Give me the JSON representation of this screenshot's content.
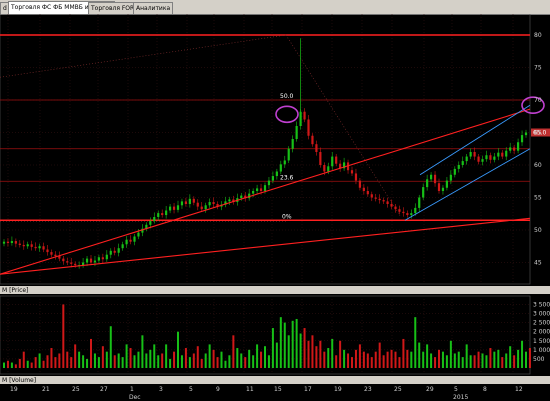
{
  "tabs": [
    {
      "label": "d"
    },
    {
      "label": "Торговля ФС ФБ ММВБ и ВР РТС"
    },
    {
      "label": "Торговля FORTS"
    },
    {
      "label": "Аналитика"
    }
  ],
  "price_panel": {
    "label": "M [Price]"
  },
  "volume_panel": {
    "label": "M [Volume]"
  },
  "last_price_marker": {
    "label": "65.0"
  },
  "fib_labels": {
    "top": "50.0",
    "mid": "23.6",
    "bottom": "0%"
  },
  "chart_data": [
    {
      "type": "candlestick",
      "title": "",
      "ylim": [
        42,
        82
      ],
      "y_ticks": [
        "80",
        "75",
        "70",
        "65",
        "60",
        "55",
        "50",
        "45"
      ],
      "x_ticks": [
        "19",
        "21",
        "25",
        "27",
        "1",
        "3",
        "5",
        "9",
        "11",
        "15",
        "17",
        "19",
        "23",
        "25",
        "29",
        "5",
        "8",
        "12"
      ],
      "x_month_labels": [
        "Dec",
        "2015"
      ],
      "horizontal_levels": [
        80,
        70,
        62.5,
        57.5,
        51.5
      ],
      "colors": {
        "up": "#17c017",
        "down": "#d01818",
        "trend": "#ff2020",
        "channel": "#3a9bff",
        "circle": "#c040d0",
        "fib": "#a01010",
        "grid": "#3a1515"
      },
      "closes": [
        48.2,
        48.0,
        48.3,
        47.9,
        47.7,
        47.5,
        47.8,
        47.4,
        47.2,
        47.5,
        47.0,
        46.6,
        46.2,
        46.0,
        45.6,
        45.2,
        45.0,
        44.8,
        44.6,
        44.6,
        45.0,
        45.6,
        45.0,
        45.3,
        45.8,
        45.5,
        46.2,
        46.8,
        46.5,
        47.2,
        47.8,
        48.5,
        48.2,
        49.0,
        49.6,
        50.2,
        50.8,
        51.4,
        52.0,
        52.6,
        52.3,
        53.0,
        53.6,
        53.1,
        53.8,
        54.4,
        54.0,
        54.8,
        54.2,
        53.6,
        53.2,
        53.8,
        54.3,
        54.0,
        53.6,
        53.9,
        54.4,
        54.7,
        54.3,
        54.9,
        55.3,
        54.9,
        55.6,
        56.0,
        56.4,
        56.0,
        56.9,
        57.6,
        58.3,
        59.0,
        60.1,
        60.7,
        62.5,
        64.0,
        66.0,
        68.2,
        67.0,
        64.5,
        63.2,
        62.0,
        60.0,
        59.0,
        59.8,
        61.3,
        60.2,
        59.5,
        60.4,
        59.2,
        58.7,
        57.6,
        56.5,
        56.0,
        55.5,
        55.0,
        54.8,
        54.6,
        54.4,
        54.0,
        53.6,
        53.2,
        52.8,
        52.6,
        52.3,
        52.6,
        53.4,
        55.0,
        56.6,
        57.8,
        58.5,
        57.2,
        56.0,
        56.5,
        57.6,
        58.5,
        59.4,
        60.0,
        60.6,
        61.3,
        62.0,
        61.3,
        60.5,
        60.9,
        61.5,
        60.8,
        61.3,
        61.9,
        61.3,
        62.2,
        62.7,
        62.2,
        63.5,
        64.6,
        65.0
      ],
      "volumes": [
        0.3,
        0.4,
        0.3,
        0.2,
        0.5,
        0.9,
        0.4,
        0.3,
        0.6,
        0.8,
        0.4,
        0.7,
        1.1,
        0.6,
        0.8,
        3.5,
        0.9,
        0.6,
        1.3,
        0.9,
        0.7,
        0.5,
        1.6,
        0.8,
        0.6,
        1.2,
        0.9,
        2.3,
        0.7,
        0.8,
        0.6,
        1.3,
        1.1,
        0.7,
        0.9,
        1.8,
        0.8,
        1.0,
        1.3,
        0.7,
        0.8,
        1.3,
        0.5,
        0.9,
        2.0,
        0.7,
        1.1,
        0.6,
        0.8,
        1.2,
        0.5,
        0.8,
        1.3,
        1.0,
        0.6,
        0.9,
        0.4,
        0.7,
        1.8,
        1.1,
        0.8,
        0.6,
        1.0,
        0.7,
        1.3,
        0.9,
        1.2,
        0.7,
        2.2,
        1.4,
        2.8,
        2.5,
        1.8,
        2.6,
        2.7,
        1.9,
        2.2,
        1.5,
        1.8,
        1.2,
        1.5,
        0.9,
        1.1,
        1.6,
        0.7,
        1.5,
        1.0,
        0.8,
        0.6,
        1.0,
        1.3,
        0.9,
        0.8,
        0.6,
        0.9,
        1.4,
        0.7,
        0.9,
        1.0,
        0.9,
        0.6,
        1.6,
        1.0,
        0.9,
        2.8,
        1.4,
        0.9,
        1.3,
        0.8,
        0.6,
        1.0,
        0.9,
        0.7,
        1.5,
        0.8,
        0.9,
        0.6,
        1.3,
        0.7,
        0.7,
        0.9,
        0.8,
        0.7,
        1.1,
        0.9,
        1.0,
        0.6,
        0.8,
        1.2,
        0.7,
        1.0,
        1.5,
        0.9,
        1.1
      ]
    }
  ],
  "volume_axis": {
    "ticks": [
      "3 500",
      "3 000",
      "2 500",
      "2 000",
      "1 500",
      "1 000",
      "500"
    ],
    "ylim": [
      0,
      3800
    ]
  }
}
